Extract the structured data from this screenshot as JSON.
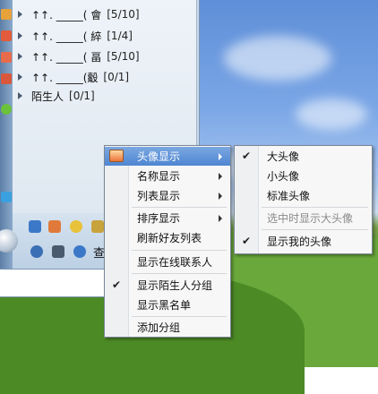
{
  "contact_list": {
    "groups": [
      {
        "name": "↑↑. _____( 會",
        "count": "[5/10]"
      },
      {
        "name": "↑↑. _____( 綷",
        "count": "[1/4]"
      },
      {
        "name": "↑↑. _____( 畐",
        "count": "[5/10]"
      },
      {
        "name": "↑↑. _____(觳",
        "count": "[0/1]"
      },
      {
        "name": "陌生人",
        "count": "[0/1]"
      }
    ]
  },
  "toolbar": {
    "find_label": "查"
  },
  "context_menu": {
    "items": [
      {
        "label": "头像显示",
        "submenu": true,
        "highlighted": true,
        "checked": false
      },
      {
        "label": "名称显示",
        "submenu": true,
        "highlighted": false,
        "checked": false
      },
      {
        "label": "列表显示",
        "submenu": true,
        "highlighted": false,
        "checked": false
      },
      {
        "label": "排序显示",
        "submenu": true,
        "highlighted": false,
        "checked": false
      },
      {
        "label": "刷新好友列表",
        "submenu": false,
        "highlighted": false,
        "checked": false
      },
      {
        "label": "显示在线联系人",
        "submenu": false,
        "highlighted": false,
        "checked": false
      },
      {
        "label": "显示陌生人分组",
        "submenu": false,
        "highlighted": false,
        "checked": true
      },
      {
        "label": "显示黑名单",
        "submenu": false,
        "highlighted": false,
        "checked": false
      },
      {
        "label": "添加分组",
        "submenu": false,
        "highlighted": false,
        "checked": false
      }
    ]
  },
  "avatar_submenu": {
    "items": [
      {
        "label": "大头像",
        "checked": true,
        "disabled": false
      },
      {
        "label": "小头像",
        "checked": false,
        "disabled": false
      },
      {
        "label": "标准头像",
        "checked": false,
        "disabled": false
      },
      {
        "label": "选中时显示大头像",
        "checked": false,
        "disabled": true
      },
      {
        "label": "显示我的头像",
        "checked": true,
        "disabled": false
      }
    ]
  },
  "colors": {
    "highlight": "#4f86d2",
    "menu_bg": "#f7f7f7"
  }
}
